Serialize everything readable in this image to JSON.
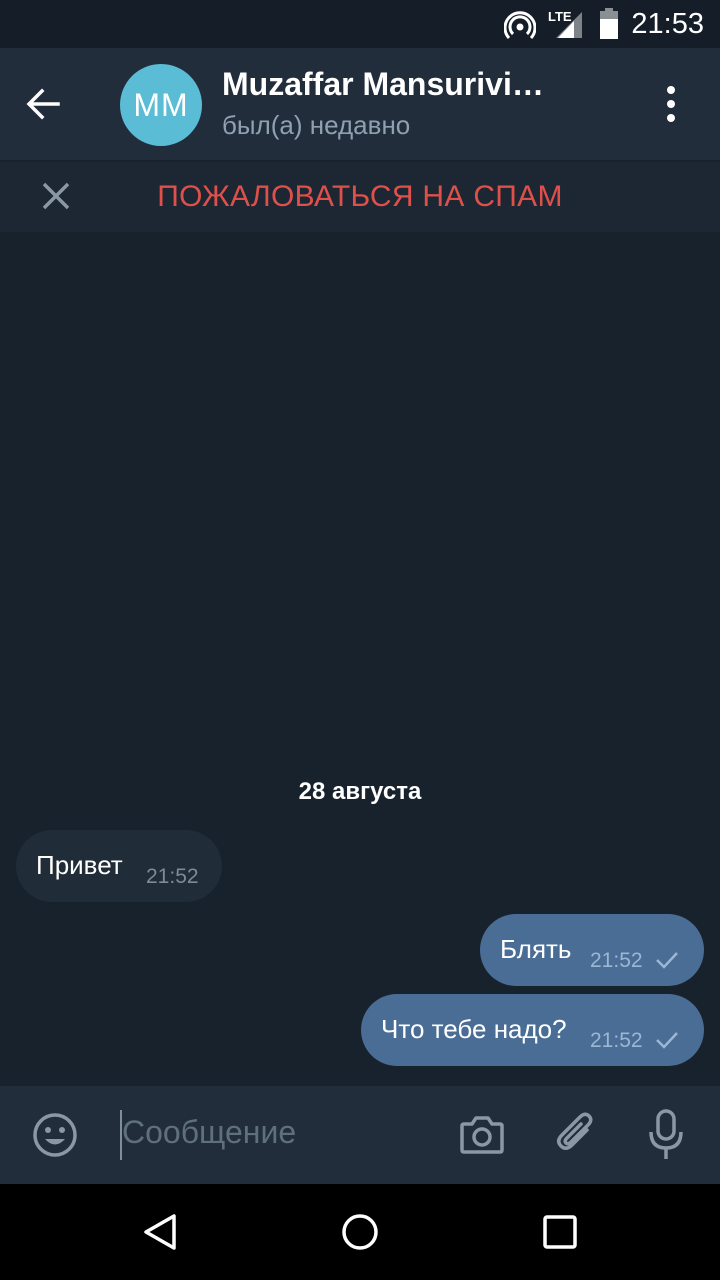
{
  "status_bar": {
    "time": "21:53",
    "network_label": "LTE",
    "icons": [
      "hotspot-icon",
      "signal-icon",
      "battery-icon"
    ]
  },
  "header": {
    "avatar_initials": "MM",
    "contact_name": "Muzaffar Mansurivi…",
    "contact_status": "был(а) недавно",
    "icons": [
      "back-arrow-icon",
      "more-vertical-icon"
    ]
  },
  "spam_bar": {
    "label": "ПОЖАЛОВАТЬСЯ НА СПАМ",
    "icons": [
      "close-icon"
    ],
    "color": "#e0504a"
  },
  "chat": {
    "date_label": "28 августа",
    "messages": [
      {
        "direction": "incoming",
        "text": "Привет",
        "time": "21:52"
      },
      {
        "direction": "outgoing",
        "text": "Блять",
        "time": "21:52",
        "status": "sent"
      },
      {
        "direction": "outgoing",
        "text": "Что тебе надо?",
        "time": "21:52",
        "status": "sent"
      }
    ]
  },
  "composer": {
    "placeholder": "Сообщение",
    "value": "",
    "icons": [
      "emoji-icon",
      "camera-icon",
      "attach-icon",
      "mic-icon"
    ]
  },
  "nav_bar": {
    "icons": [
      "nav-back-icon",
      "nav-home-icon",
      "nav-recents-icon"
    ]
  },
  "colors": {
    "background": "#18222d",
    "header": "#212d3b",
    "outgoing_bubble": "#4a6d96",
    "incoming_bubble": "#202c38",
    "avatar": "#5bbcd6"
  }
}
